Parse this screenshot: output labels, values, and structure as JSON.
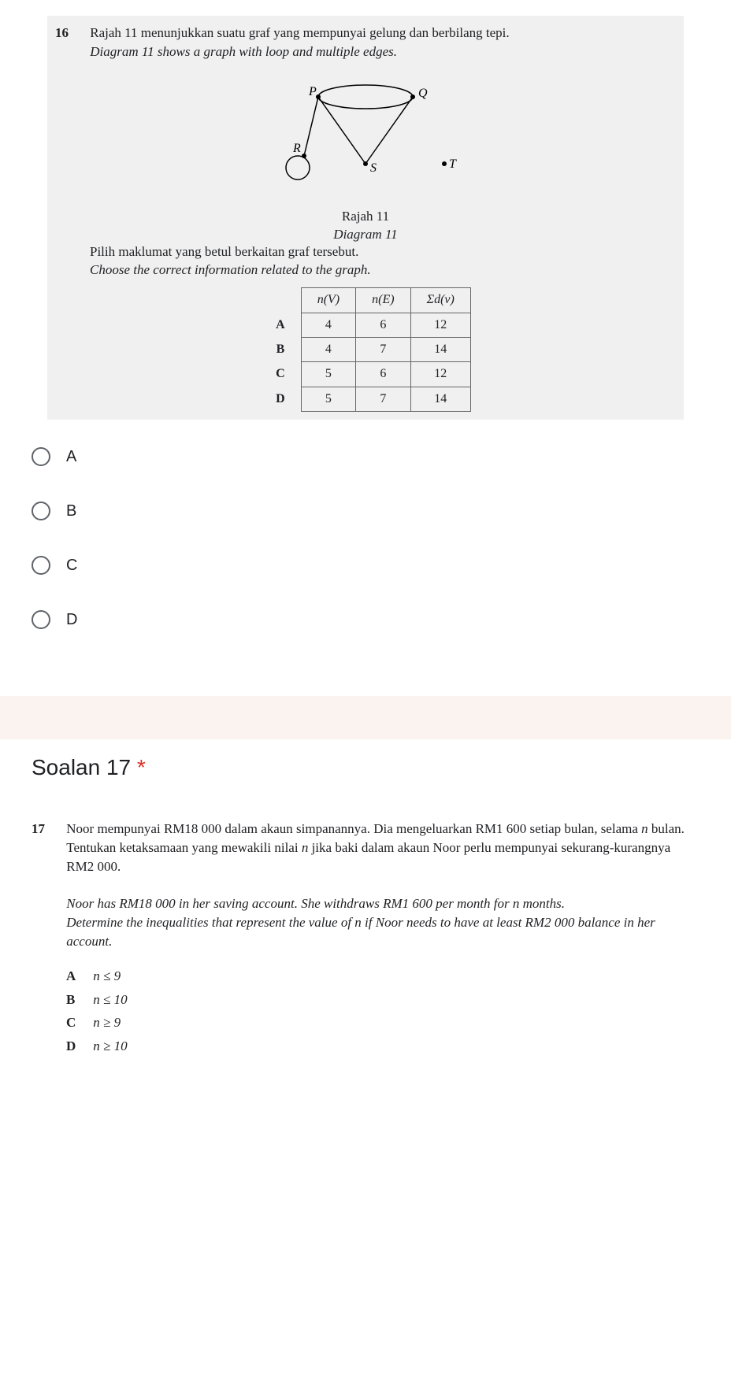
{
  "question16": {
    "number": "16",
    "text_my": "Rajah 11 menunjukkan suatu graf yang mempunyai gelung dan berbilang tepi.",
    "text_en": "Diagram 11 shows a graph with loop and multiple edges.",
    "graph": {
      "vertices": [
        "P",
        "Q",
        "R",
        "S",
        "T"
      ]
    },
    "diagram_label_my": "Rajah 11",
    "diagram_label_en": "Diagram 11",
    "instruction_my": "Pilih maklumat yang betul berkaitan graf tersebut.",
    "instruction_en": "Choose the correct information related to the graph.",
    "table": {
      "headers": [
        "n(V)",
        "n(E)",
        "Σd(v)"
      ],
      "rows": [
        {
          "label": "A",
          "values": [
            "4",
            "6",
            "12"
          ]
        },
        {
          "label": "B",
          "values": [
            "4",
            "7",
            "14"
          ]
        },
        {
          "label": "C",
          "values": [
            "5",
            "6",
            "12"
          ]
        },
        {
          "label": "D",
          "values": [
            "5",
            "7",
            "14"
          ]
        }
      ]
    },
    "options": [
      "A",
      "B",
      "C",
      "D"
    ]
  },
  "question17": {
    "title": "Soalan 17",
    "required_mark": "*",
    "number": "17",
    "text_my_1": "Noor mempunyai RM18 000 dalam akaun simpanannya.  Dia mengeluarkan RM1 600 setiap bulan, selama ",
    "text_my_n": "n",
    "text_my_2": " bulan.",
    "text_my_3": "Tentukan ketaksamaan yang mewakili nilai ",
    "text_my_4": " jika baki dalam akaun Noor perlu mempunyai sekurang-kurangnya RM2 000.",
    "text_en_1": "Noor has RM18 000 in her saving account.  She withdraws RM1 600 per month for n months.",
    "text_en_2": "Determine the inequalities that represent the value of n if Noor needs to have at least RM2 000 balance in her account.",
    "options": [
      {
        "label": "A",
        "text": "n ≤ 9"
      },
      {
        "label": "B",
        "text": "n ≤ 10"
      },
      {
        "label": "C",
        "text": "n ≥ 9"
      },
      {
        "label": "D",
        "text": "n ≥ 10"
      }
    ]
  }
}
